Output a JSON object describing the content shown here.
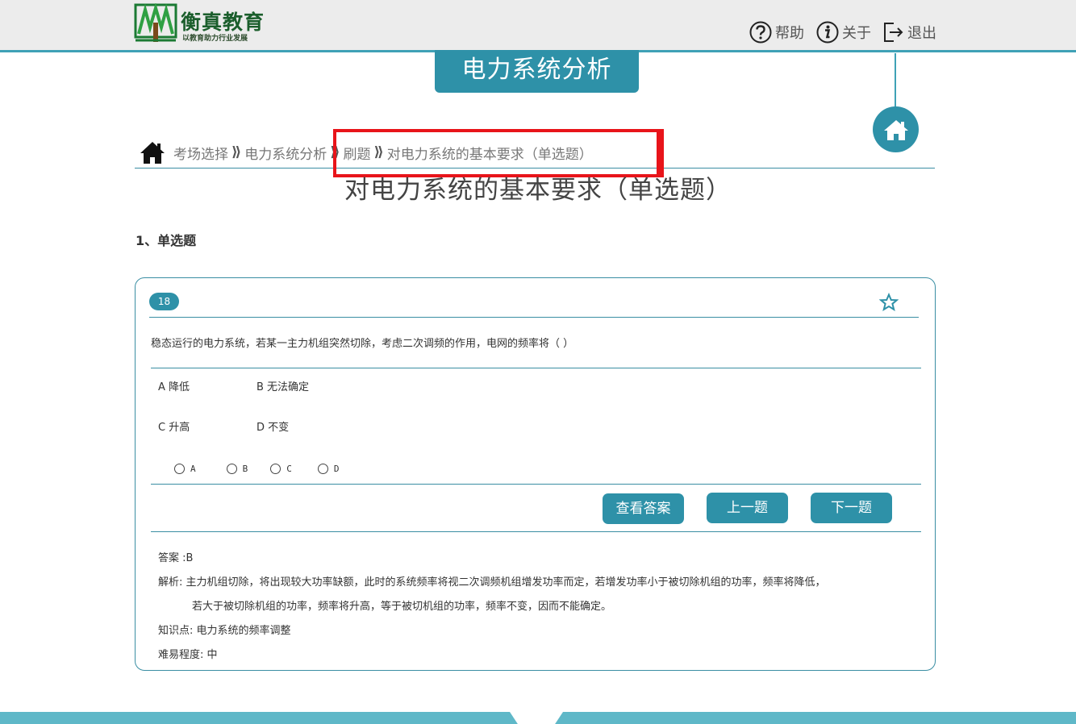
{
  "header": {
    "logo_title": "衡真教育",
    "logo_slogan": "以教育助力行业发展",
    "nav": [
      {
        "label": "帮助",
        "icon": "help-icon"
      },
      {
        "label": "关于",
        "icon": "info-icon"
      },
      {
        "label": "退出",
        "icon": "logout-icon"
      }
    ]
  },
  "course_title": "电力系统分析",
  "breadcrumb": {
    "items": [
      "考场选择",
      "电力系统分析",
      "刷题"
    ],
    "current": "对电力系统的基本要求（单选题）",
    "separator": "⟫"
  },
  "page_heading": "对电力系统的基本要求（单选题）",
  "section_title": "1、单选题",
  "question": {
    "number": "18",
    "text": "稳态运行的电力系统，若某一主力机组突然切除，考虑二次调频的作用，电网的频率将（ ）",
    "options": {
      "a": "A 降低",
      "b": "B 无法确定",
      "c": "C 升高",
      "d": "D 不变"
    },
    "choices": [
      "A",
      "B",
      "C",
      "D"
    ],
    "buttons": {
      "show_answer": "查看答案",
      "prev": "上一题",
      "next": "下一题"
    },
    "answer_line": "答案 :B",
    "analysis_1": "解析: 主力机组切除，将出现较大功率缺额，此时的系统频率将视二次调频机组增发功率而定，若增发功率小于被切除机组的功率，频率将降低，",
    "analysis_2": "若大于被切除机组的功率，频率将升高，等于被切机组的功率，频率不变，因而不能确定。",
    "knowledge": "知识点: 电力系统的频率调整",
    "difficulty": "难易程度: 中"
  },
  "colors": {
    "accent": "#2e91a8",
    "rule": "#3a8ea3",
    "highlight": "#e8141a",
    "footer": "#5fb8c8"
  }
}
